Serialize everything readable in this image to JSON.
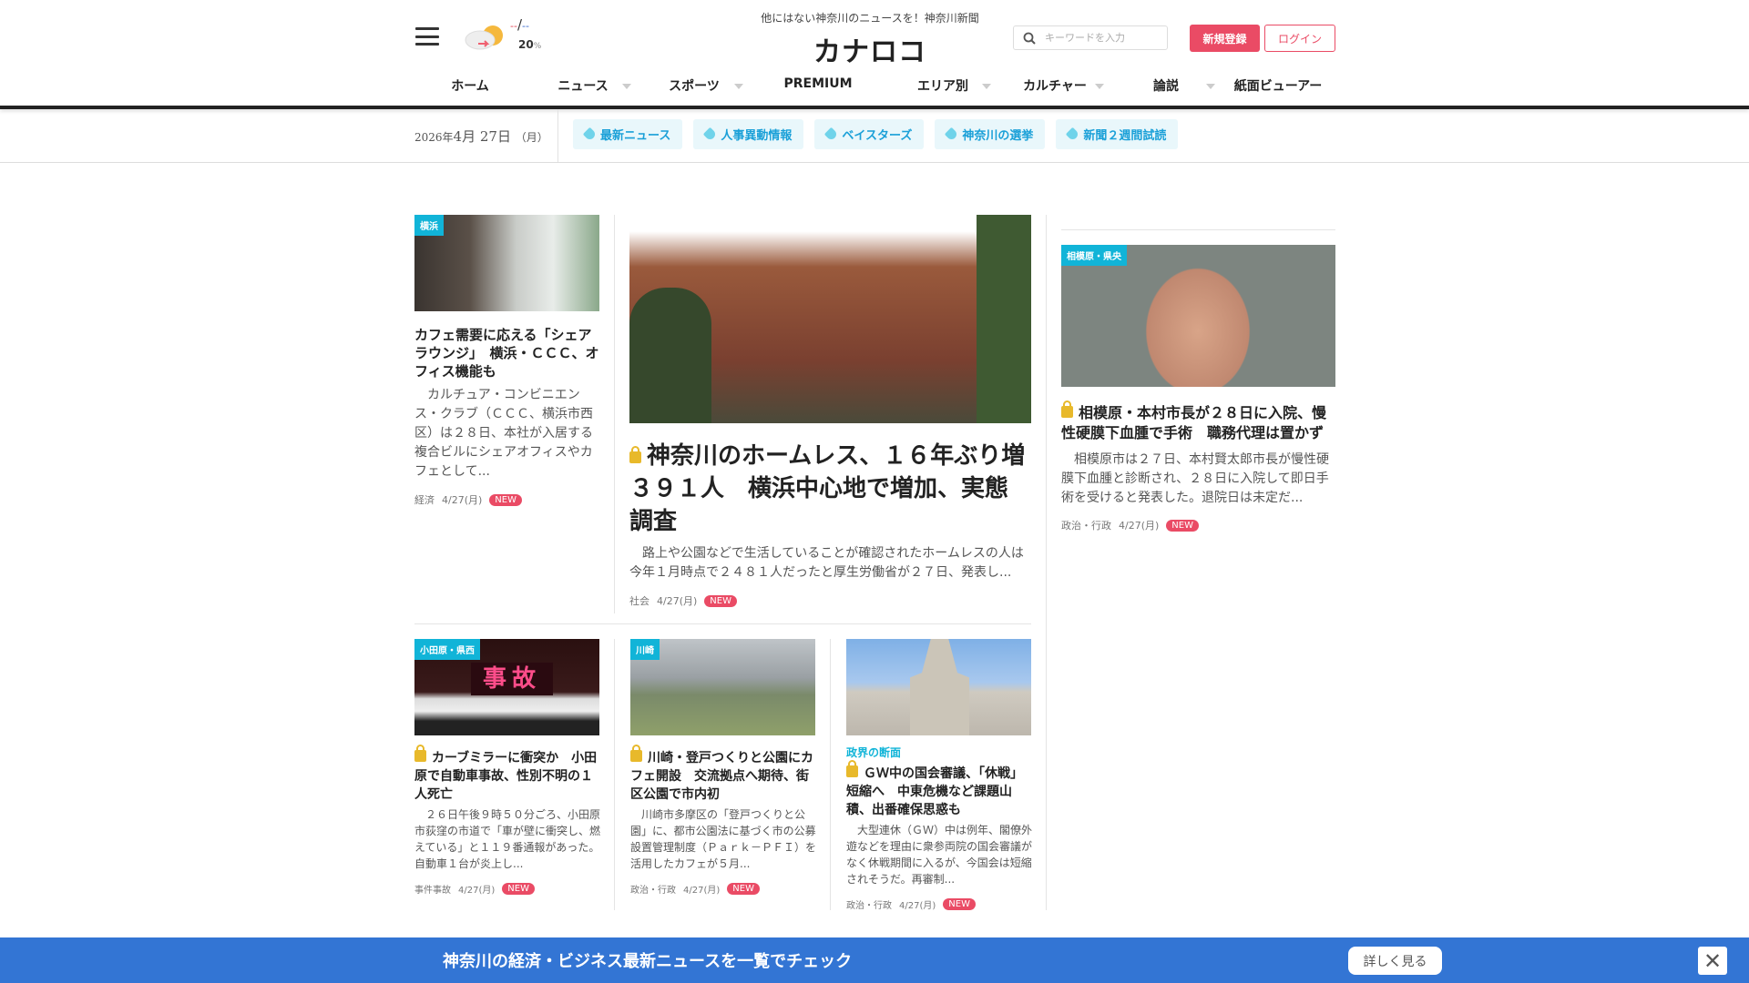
{
  "header": {
    "tagline": "他にはない神奈川のニュースを！神奈川新聞",
    "logo": "カナロコ",
    "weather": {
      "icon": "cloud-sun-icon",
      "high": "--",
      "low": "--",
      "separator": "/",
      "rain": "20",
      "rain_unit": "%"
    },
    "search_placeholder": "キーワードを入力",
    "register": "新規登録",
    "login": "ログイン"
  },
  "nav": [
    {
      "label": "ホーム"
    },
    {
      "label": "ニュース"
    },
    {
      "label": "スポーツ"
    },
    {
      "label": "PREMIUM"
    },
    {
      "label": "エリア別"
    },
    {
      "label": "カルチャー"
    },
    {
      "label": "論説"
    },
    {
      "label": "紙面ビューアー"
    }
  ],
  "subbar": {
    "date_year": "2026年",
    "date_month": "4月",
    "date_day": "27日",
    "date_weekday": "（月）",
    "tags": [
      "最新ニュース",
      "人事異動情報",
      "ベイスターズ",
      "神奈川の選挙",
      "新聞２週間試読"
    ]
  },
  "articles": [
    {
      "badge": "横浜",
      "title": "カフェ需要に応える「シェアラウンジ」　横浜・ＣＣＣ、オフィス機能も",
      "body": "　カルチュア・コンビニエンス・クラブ（ＣＣＣ、横浜市西区）は２８日、本社が入居する複合ビルにシェアオフィスやカフェとして...",
      "category": "経済",
      "date": "4/27(月)",
      "new": "NEW"
    },
    {
      "title": "神奈川のホームレス、１６年ぶり増３９１人　横浜中心地で増加、実態調査",
      "body": "　路上や公園などで生活していることが確認されたホームレスの人は今年１月時点で２４８１人だったと厚生労働省が２７日、発表し...",
      "category": "社会",
      "date": "4/27(月)",
      "new": "NEW"
    },
    {
      "badge": "相模原・県央",
      "title": "相模原・本村市長が２８日に入院、慢性硬膜下血腫で手術　職務代理は置かず",
      "body": "　相模原市は２７日、本村賢太郎市長が慢性硬膜下血腫と診断され、２８日に入院して即日手術を受けると発表した。退院日は未定だ...",
      "category": "政治・行政",
      "date": "4/27(月)",
      "new": "NEW"
    },
    {
      "badge": "小田原・県西",
      "title": "カーブミラーに衝突か　小田原で自動車事故、性別不明の１人死亡",
      "body": "　２６日午後９時５０分ごろ、小田原市荻窪の市道で「車が壁に衝突し、燃えている」と１１９番通報があった。自動車１台が炎上し...",
      "category": "事件事故",
      "date": "4/27(月)",
      "new": "NEW",
      "image_text": "事故"
    },
    {
      "badge": "川崎",
      "title": "川崎・登戸つくりと公園にカフェ開設　交流拠点へ期待、街区公園で市内初",
      "body": "　川崎市多摩区の「登戸つくりと公園」に、都市公園法に基づく市の公募設置管理制度（Ｐａｒｋ－ＰＦＩ）を活用したカフェが５月...",
      "category": "政治・行政",
      "date": "4/27(月)",
      "new": "NEW"
    },
    {
      "series": "政界の断面",
      "title": "ＧＷ中の国会審議、「休戦」短縮へ　中東危機など課題山積、出番確保思惑も",
      "body": "　大型連休（ＧＷ）中は例年、閣僚外遊などを理由に衆参両院の国会審議がなく休戦期間に入るが、今国会は短縮されそうだ。再審制...",
      "category": "政治・行政",
      "date": "4/27(月)",
      "new": "NEW"
    }
  ],
  "banner": {
    "text": "神奈川の経済・ビジネス最新ニュースを一覧でチェック",
    "button": "詳しく見る",
    "close": "✕"
  },
  "colors": {
    "accent": "#ea4b65",
    "tag": "#1aa0d8",
    "banner": "#3375d4",
    "badge": "#11b4d8"
  }
}
